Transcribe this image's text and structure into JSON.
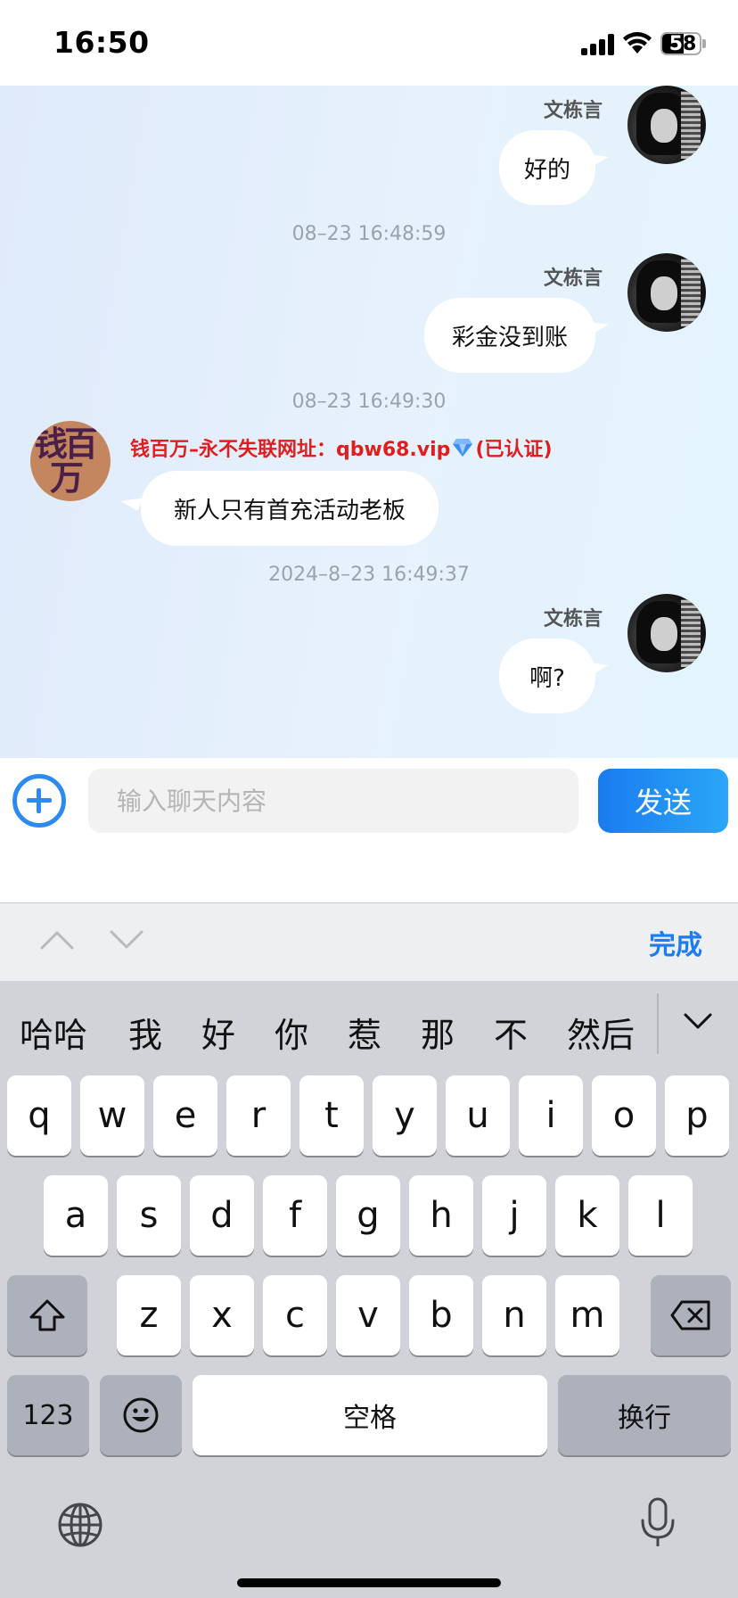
{
  "status_bar": {
    "time": "16:50",
    "battery": "58",
    "battery_level": 0.58
  },
  "messages": [
    {
      "sender": "文栋言",
      "text": "好的"
    },
    {
      "timestamp": "08–23 16:48:59"
    },
    {
      "sender": "文栋言",
      "text": "彩金没到账"
    },
    {
      "timestamp": "08–23 16:49:30"
    },
    {
      "sender_line_prefix": "钱百万–永不失联网址：qbw68.vip",
      "sender_line_suffix": "(已认证)",
      "avatar_line1": "钱百",
      "avatar_line2": "万",
      "text": "新人只有首充活动老板"
    },
    {
      "timestamp": "2024–8–23 16:49:37"
    },
    {
      "sender": "文栋言",
      "text": "啊?"
    }
  ],
  "input": {
    "placeholder": "输入聊天内容",
    "value": "",
    "send_label": "发送"
  },
  "toolbar": {
    "done_label": "完成"
  },
  "keyboard": {
    "candidates": [
      "哈哈",
      "我",
      "好",
      "你",
      "惹",
      "那",
      "不",
      "然后"
    ],
    "row1": [
      "q",
      "w",
      "e",
      "r",
      "t",
      "y",
      "u",
      "i",
      "o",
      "p"
    ],
    "row2": [
      "a",
      "s",
      "d",
      "f",
      "g",
      "h",
      "j",
      "k",
      "l"
    ],
    "row3": [
      "z",
      "x",
      "c",
      "v",
      "b",
      "n",
      "m"
    ],
    "numbers_label": "123",
    "space_label": "空格",
    "return_label": "换行"
  },
  "colors": {
    "accent": "#1d7cf2",
    "brand_red": "#e01e1e"
  }
}
